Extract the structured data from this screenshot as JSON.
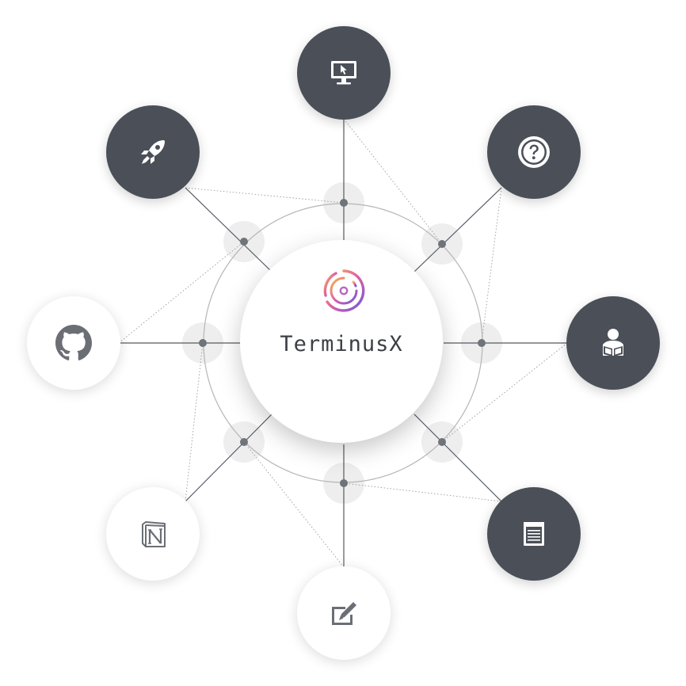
{
  "hub": {
    "brand": "TerminusX",
    "icon": "terminusx-logo-icon",
    "colors": {
      "ring_start": "#f5b942",
      "ring_mid": "#e05fa8",
      "ring_end": "#6a5bd6",
      "text": "#3c3f45"
    }
  },
  "nodes": [
    {
      "id": "dashboard",
      "icon": "monitor-cursor-icon",
      "style": "dark"
    },
    {
      "id": "help",
      "icon": "question-circle-icon",
      "style": "dark"
    },
    {
      "id": "docs",
      "icon": "reader-book-icon",
      "style": "dark"
    },
    {
      "id": "blog",
      "icon": "document-icon",
      "style": "dark"
    },
    {
      "id": "edit",
      "icon": "edit-pen-icon",
      "style": "light"
    },
    {
      "id": "notion",
      "icon": "notion-logo-icon",
      "style": "light"
    },
    {
      "id": "github",
      "icon": "github-logo-icon",
      "style": "light"
    },
    {
      "id": "quickstart",
      "icon": "rocket-icon",
      "style": "dark"
    }
  ],
  "colors": {
    "dark_node": "#4b4f58",
    "light_node": "#ffffff",
    "icon_on_dark": "#ffffff",
    "icon_on_light": "#6b6e75",
    "connector": "#555a62",
    "ring": "#b5b5b5",
    "joint": "#6f737a"
  }
}
